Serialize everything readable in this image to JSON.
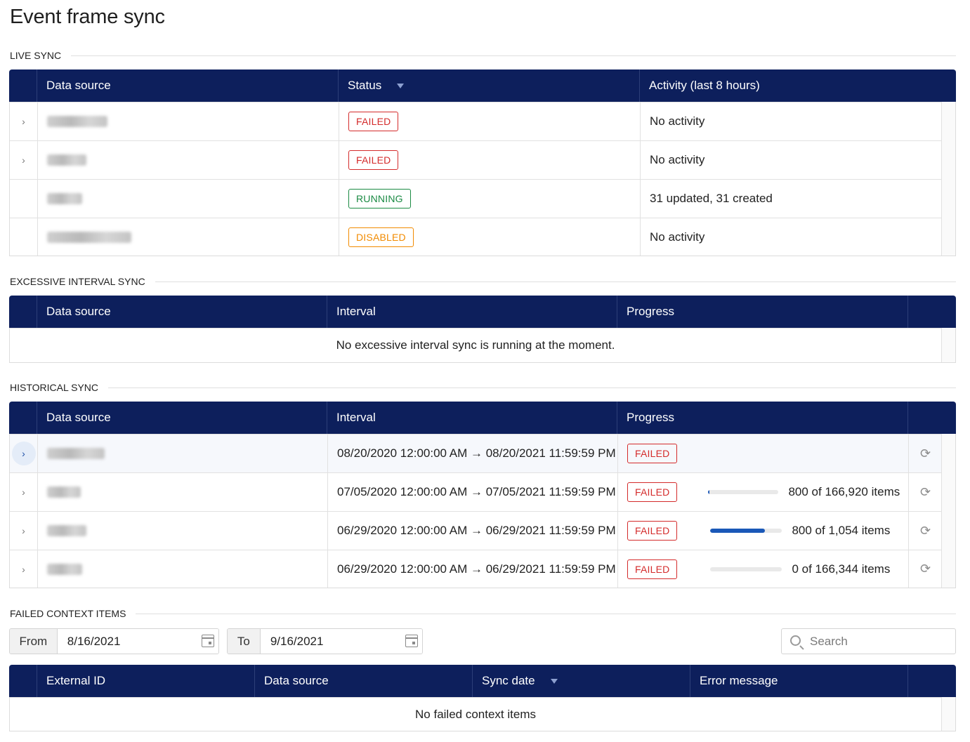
{
  "page": {
    "title": "Event frame sync"
  },
  "live_sync": {
    "section_label": "LIVE SYNC",
    "columns": {
      "data_source": "Data source",
      "status": "Status",
      "activity": "Activity (last 8 hours)"
    },
    "rows": [
      {
        "status": "FAILED",
        "activity": "No activity",
        "expandable": true
      },
      {
        "status": "FAILED",
        "activity": "No activity",
        "expandable": true
      },
      {
        "status": "RUNNING",
        "activity": "31 updated, 31 created",
        "expandable": false
      },
      {
        "status": "DISABLED",
        "activity": "No activity",
        "expandable": false
      }
    ]
  },
  "excessive_sync": {
    "section_label": "EXCESSIVE INTERVAL SYNC",
    "columns": {
      "data_source": "Data source",
      "interval": "Interval",
      "progress": "Progress"
    },
    "empty_message": "No excessive interval sync is running at the moment."
  },
  "historical_sync": {
    "section_label": "HISTORICAL SYNC",
    "columns": {
      "data_source": "Data source",
      "interval": "Interval",
      "progress": "Progress"
    },
    "rows": [
      {
        "interval": "08/20/2020 12:00:00 AM → 08/20/2021 11:59:59 PM",
        "status": "FAILED",
        "progress_text": "",
        "progress_fraction": null
      },
      {
        "interval": "07/05/2020 12:00:00 AM → 07/05/2021 11:59:59 PM",
        "status": "FAILED",
        "progress_text": "800 of 166,920 items",
        "progress_fraction": 0.0048
      },
      {
        "interval": "06/29/2020 12:00:00 AM → 06/29/2021 11:59:59 PM",
        "status": "FAILED",
        "progress_text": "800 of 1,054 items",
        "progress_fraction": 0.759
      },
      {
        "interval": "06/29/2020 12:00:00 AM → 06/29/2021 11:59:59 PM",
        "status": "FAILED",
        "progress_text": "0 of 166,344 items",
        "progress_fraction": 0
      }
    ]
  },
  "failed_context": {
    "section_label": "FAILED CONTEXT ITEMS",
    "from_label": "From",
    "from_value": "8/16/2021",
    "to_label": "To",
    "to_value": "9/16/2021",
    "search_placeholder": "Search",
    "columns": {
      "external_id": "External ID",
      "data_source": "Data source",
      "sync_date": "Sync date",
      "error_message": "Error message"
    },
    "empty_message": "No failed context items"
  },
  "colors": {
    "header_bg": "#0d1f5c",
    "failed": "#d42b2b",
    "running": "#1a8a43",
    "disabled": "#f28b00",
    "progress_fill": "#1a58b8"
  }
}
